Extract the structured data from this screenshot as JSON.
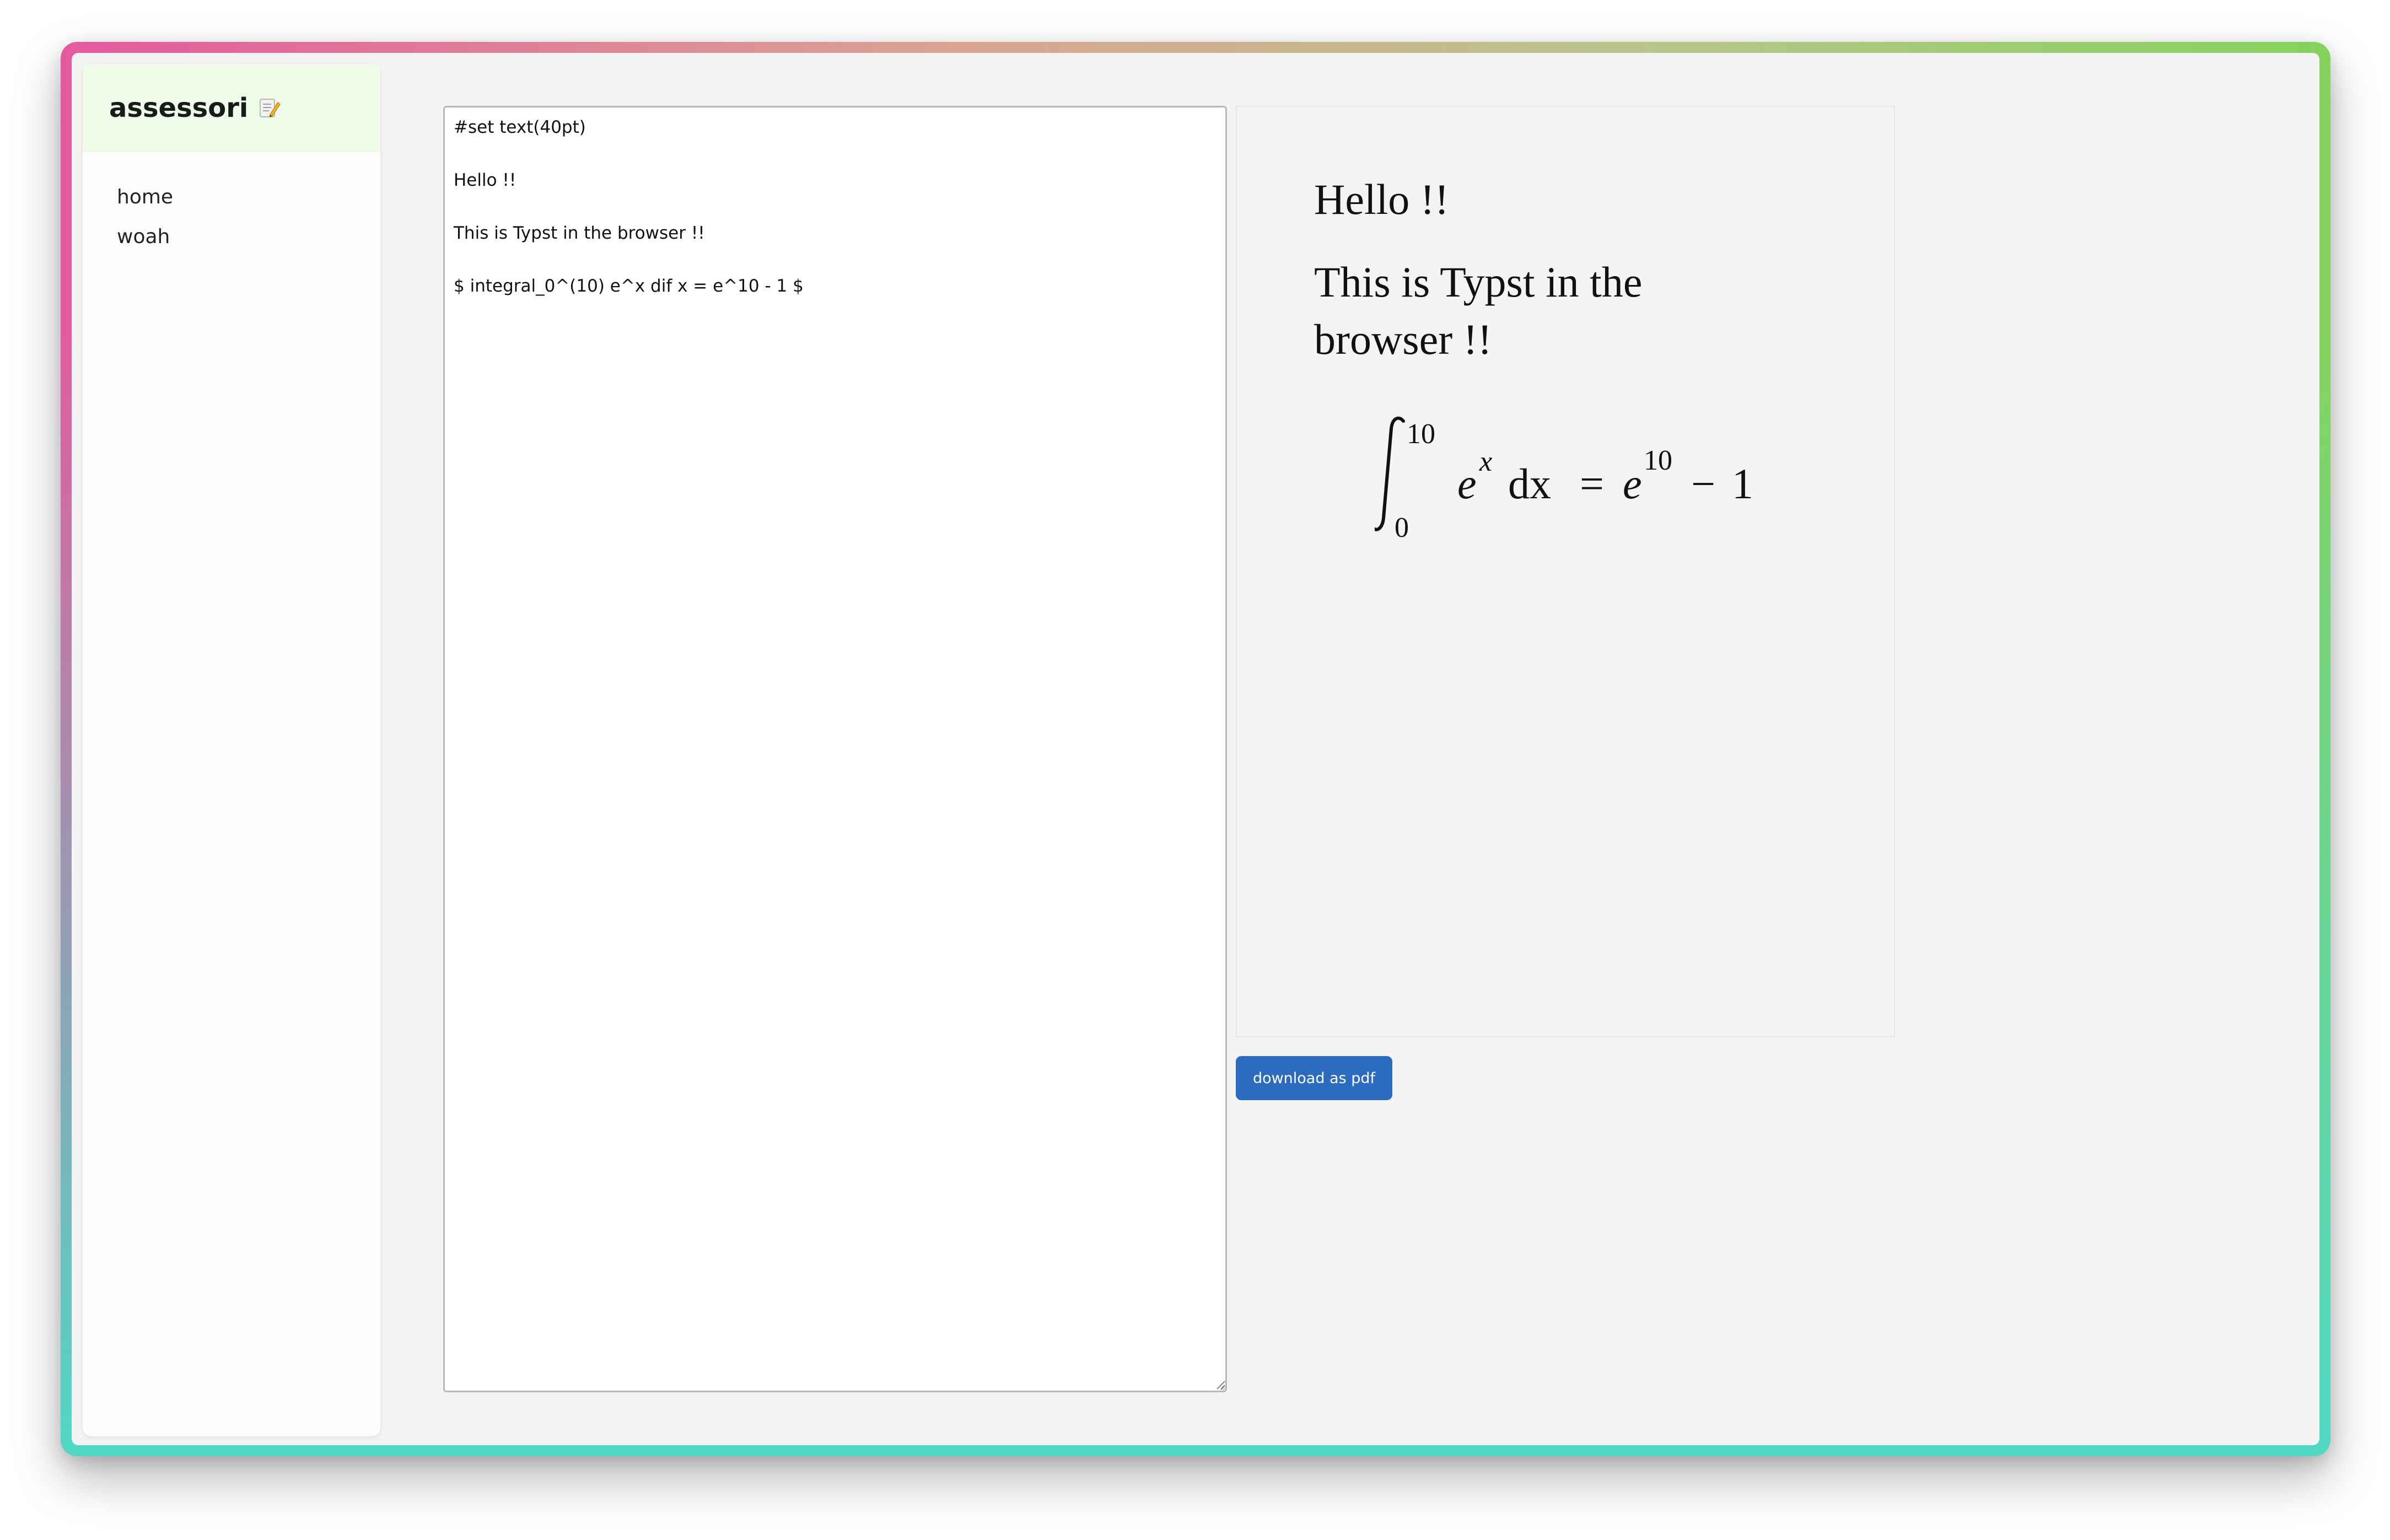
{
  "sidebar": {
    "title": "assessori",
    "title_icon": "memo-icon",
    "items": [
      {
        "label": "home"
      },
      {
        "label": "woah"
      }
    ]
  },
  "editor": {
    "content": "#set text(40pt)\n\nHello !!\n\nThis is Typst in the browser !!\n\n$ integral_0^(10) e^x dif x = e^10 - 1 $"
  },
  "preview": {
    "line1": "Hello !!",
    "line2": "This is Typst in the",
    "line3": "browser !!",
    "math": {
      "integral_lower": "0",
      "integral_upper": "10",
      "base": "e",
      "exponent": "x",
      "differential": "dx",
      "equals": "=",
      "rhs_base": "e",
      "rhs_exponent": "10",
      "minus": "−",
      "rhs_const": "1"
    }
  },
  "actions": {
    "download_label": "download as pdf"
  },
  "colors": {
    "accent": "#2b6cc0",
    "sidebar_header": "#eefbe9",
    "frame_top_left": "#e45a9e",
    "frame_top_right": "#84d35e",
    "frame_bottom": "#4fd8c4"
  }
}
